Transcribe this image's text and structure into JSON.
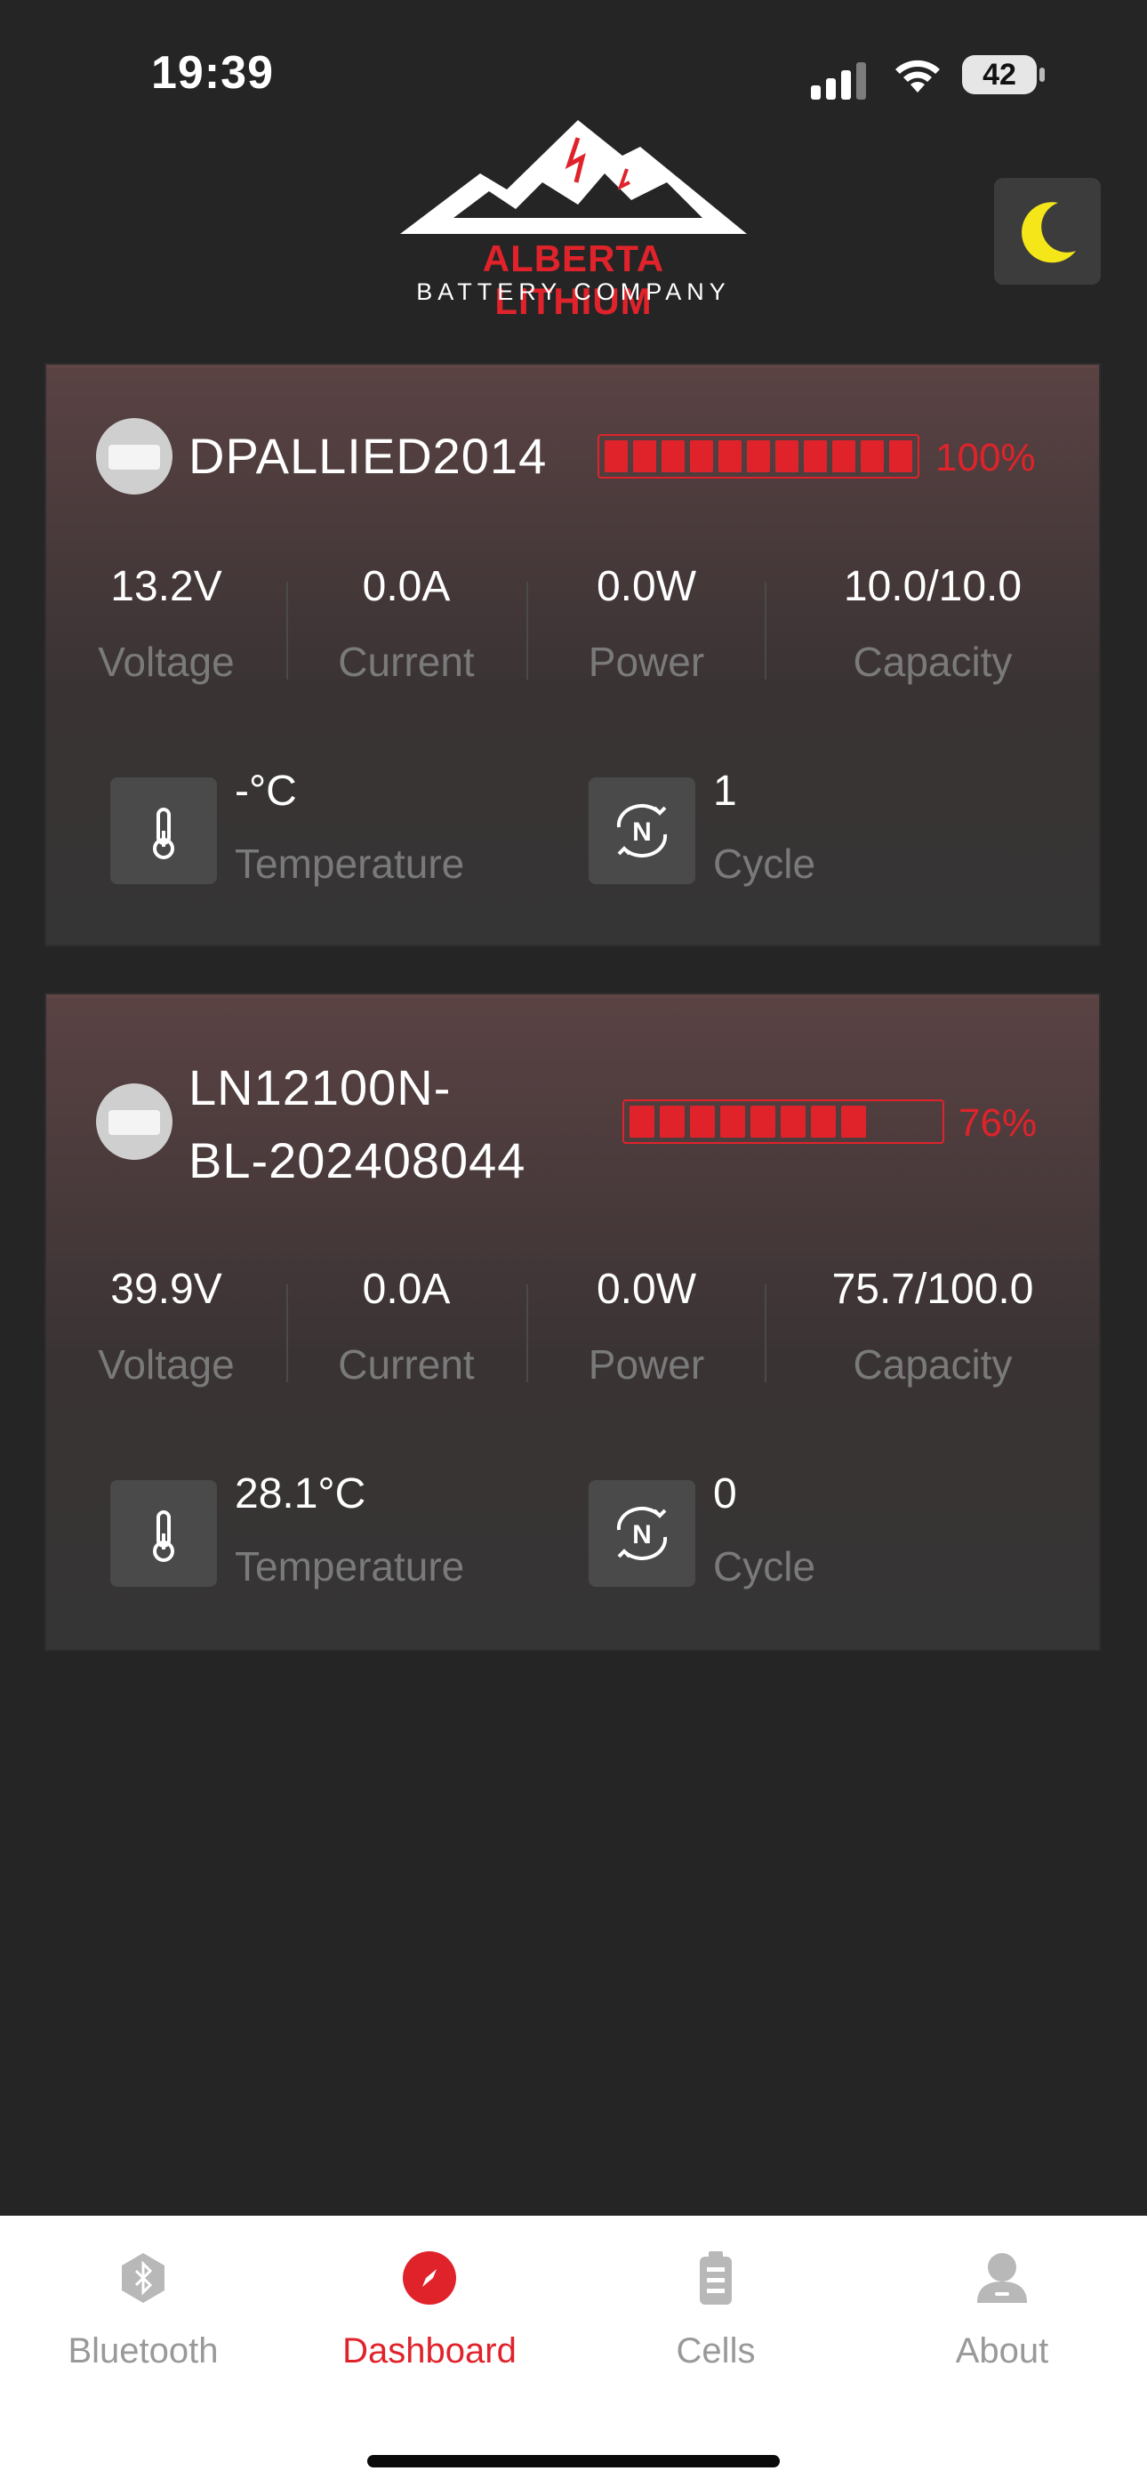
{
  "status": {
    "time": "19:39",
    "battery": "42"
  },
  "header": {
    "logo_line1": "ALBERTA LITHIUM",
    "logo_line2": "BATTERY COMPANY",
    "theme_icon": "moon-icon"
  },
  "batteries": [
    {
      "name": "DPALLIED2014",
      "percent_label": "100%",
      "level": 1.0,
      "voltage": "13.2V",
      "current": "0.0A",
      "power": "0.0W",
      "capacity": "10.0/10.0",
      "temperature": "-°C",
      "cycle": "1"
    },
    {
      "name_line1": "LN12100N-",
      "name_line2": "BL-202408044",
      "percent_label": "76%",
      "level": 0.76,
      "voltage": "39.9V",
      "current": "0.0A",
      "power": "0.0W",
      "capacity": "75.7/100.0",
      "temperature": "28.1°C",
      "cycle": "0"
    }
  ],
  "labels": {
    "voltage": "Voltage",
    "current": "Current",
    "power": "Power",
    "capacity": "Capacity",
    "temperature": "Temperature",
    "cycle": "Cycle"
  },
  "tabs": [
    {
      "label": "Bluetooth",
      "icon": "bluetooth-icon",
      "active": false
    },
    {
      "label": "Dashboard",
      "icon": "compass-icon",
      "active": true
    },
    {
      "label": "Cells",
      "icon": "battery-cells-icon",
      "active": false
    },
    {
      "label": "About",
      "icon": "user-icon",
      "active": false
    }
  ],
  "colors": {
    "accent": "#e0232b",
    "background": "#252525",
    "moon": "#f5e61a"
  }
}
